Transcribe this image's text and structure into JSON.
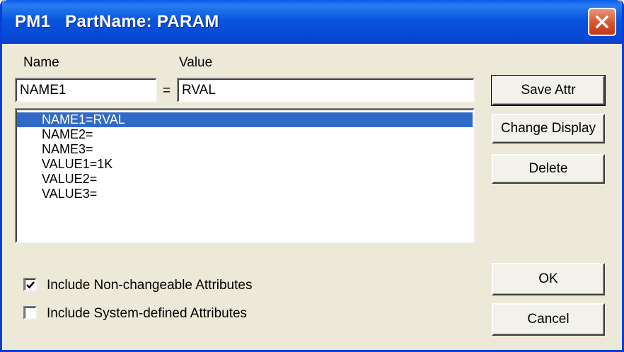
{
  "window": {
    "title": "PM1   PartName: PARAM",
    "close_icon": "close-icon",
    "accent_color": "#0a55df",
    "close_color": "#d4542f"
  },
  "labels": {
    "name": "Name",
    "value": "Value",
    "equals": "="
  },
  "fields": {
    "name_value": "NAME1",
    "value_value": "RVAL"
  },
  "list": {
    "selected_index": 0,
    "items": [
      "NAME1=RVAL",
      "NAME2=",
      "NAME3=",
      "VALUE1=1K",
      "VALUE2=",
      "VALUE3="
    ]
  },
  "buttons": {
    "save_attr": "Save Attr",
    "change_display": "Change Display",
    "delete": "Delete",
    "ok": "OK",
    "cancel": "Cancel"
  },
  "checkboxes": {
    "non_changeable": {
      "label": "Include Non-changeable Attributes",
      "checked": true
    },
    "system_defined": {
      "label": "Include System-defined Attributes",
      "checked": false
    }
  }
}
